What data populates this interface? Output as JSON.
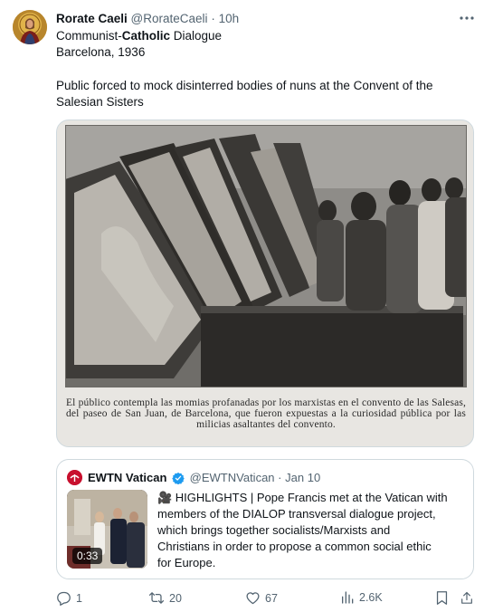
{
  "tweet": {
    "author_name": "Rorate Caeli",
    "author_handle": "@RorateCaeli",
    "separator": "·",
    "time": "10h",
    "more_icon": "more-horizontal-icon",
    "line1_pre": "Communist-",
    "line1_bold": "Catholic",
    "line1_post": " Dialogue",
    "line2": "Barcelona, 1936",
    "line3": "Public forced to mock disinterred bodies of nuns at the Convent of the",
    "line4": "Salesian Sisters"
  },
  "photo": {
    "caption": "El público contempla las momias profanadas por los marxistas en el convento de las Salesas, del paseo de San Juan, de Barcelona, que fueron expuestas a la curiosidad pública por las milicias asaltantes del convento."
  },
  "quoted": {
    "author_name": "EWTN Vatican",
    "author_handle": "@EWTNVatican",
    "separator": "·",
    "time": "Jan 10",
    "video_duration": "0:33",
    "line1": "🎥 HIGHLIGHTS | Pope Francis met at the Vatican with",
    "line2": "members of the DIALOP transversal dialogue project,",
    "line3": "which brings together socialists/Marxists and",
    "line4": "Christians in order to propose a common social ethic",
    "line5": "for Europe."
  },
  "actions": {
    "replies": "1",
    "retweets": "20",
    "likes": "67",
    "views": "2.6K"
  },
  "colors": {
    "text_primary": "#0f1419",
    "text_secondary": "#536471",
    "border": "#cfd9de",
    "verified": "#1d9bf0",
    "ewtn_red": "#c8102e"
  }
}
